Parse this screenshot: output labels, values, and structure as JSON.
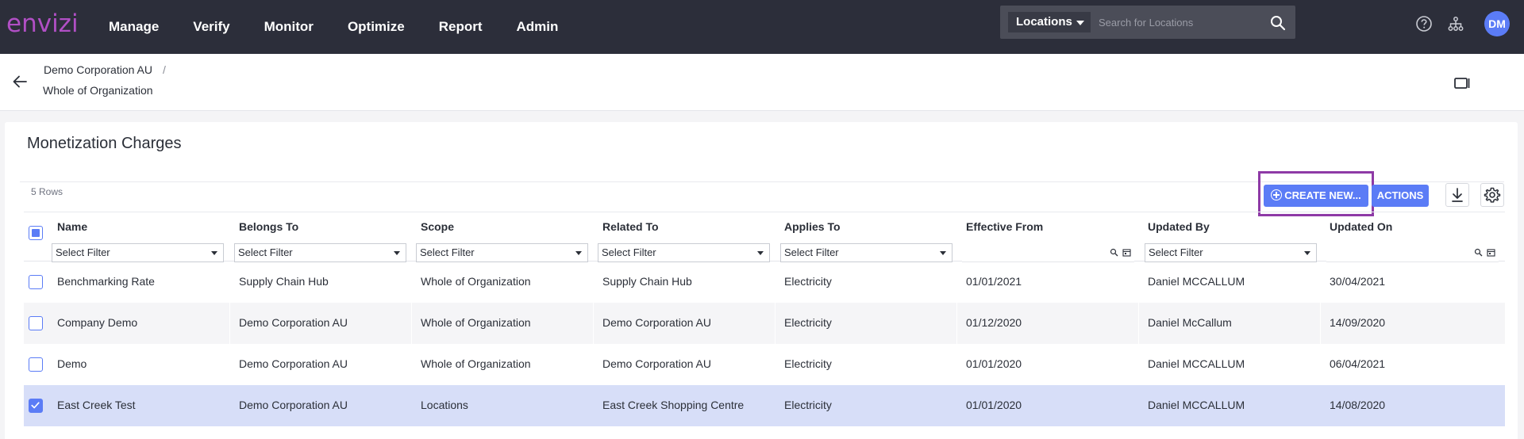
{
  "app": {
    "logo": "envizi",
    "nav": [
      "Manage",
      "Verify",
      "Monitor",
      "Optimize",
      "Report",
      "Admin"
    ],
    "search": {
      "scope": "Locations",
      "placeholder": "Search for Locations"
    },
    "avatar": "DM"
  },
  "breadcrumb": {
    "parent": "Demo Corporation AU",
    "separator": "/",
    "current": "Whole of Organization"
  },
  "page": {
    "title": "Monetization Charges",
    "rows_count": "5 Rows",
    "create_label": "CREATE NEW...",
    "actions_label": "ACTIONS"
  },
  "table": {
    "columns": [
      "Name",
      "Belongs To",
      "Scope",
      "Related To",
      "Applies To",
      "Effective From",
      "Updated By",
      "Updated On"
    ],
    "filter_placeholder": "Select Filter",
    "rows": [
      {
        "name": "Benchmarking Rate",
        "belongs_to": "Supply Chain Hub",
        "scope": "Whole of Organization",
        "related_to": "Supply Chain Hub",
        "applies_to": "Electricity",
        "effective_from": "01/01/2021",
        "updated_by": "Daniel MCCALLUM",
        "updated_on": "30/04/2021",
        "checked": false
      },
      {
        "name": "Company Demo",
        "belongs_to": "Demo Corporation AU",
        "scope": "Whole of Organization",
        "related_to": "Demo Corporation AU",
        "applies_to": "Electricity",
        "effective_from": "01/12/2020",
        "updated_by": "Daniel McCallum",
        "updated_on": "14/09/2020",
        "checked": false
      },
      {
        "name": "Demo",
        "belongs_to": "Demo Corporation AU",
        "scope": "Whole of Organization",
        "related_to": "Demo Corporation AU",
        "applies_to": "Electricity",
        "effective_from": "01/01/2020",
        "updated_by": "Daniel MCCALLUM",
        "updated_on": "06/04/2021",
        "checked": false
      },
      {
        "name": "East Creek Test",
        "belongs_to": "Demo Corporation AU",
        "scope": "Locations",
        "related_to": "East Creek Shopping Centre",
        "applies_to": "Electricity",
        "effective_from": "01/01/2020",
        "updated_by": "Daniel MCCALLUM",
        "updated_on": "14/08/2020",
        "checked": true
      }
    ]
  },
  "colors": {
    "accent": "#5b7cf6",
    "highlight": "#8e3aa6",
    "topbar": "#2c2e3a",
    "logo": "#b14fc5",
    "selected_row": "#d7def8"
  },
  "icons": [
    "search-icon",
    "help-icon",
    "hierarchy-icon",
    "back-arrow-icon",
    "panel-icon",
    "download-icon",
    "gear-icon",
    "plus-circle-icon",
    "calendar-icon"
  ]
}
